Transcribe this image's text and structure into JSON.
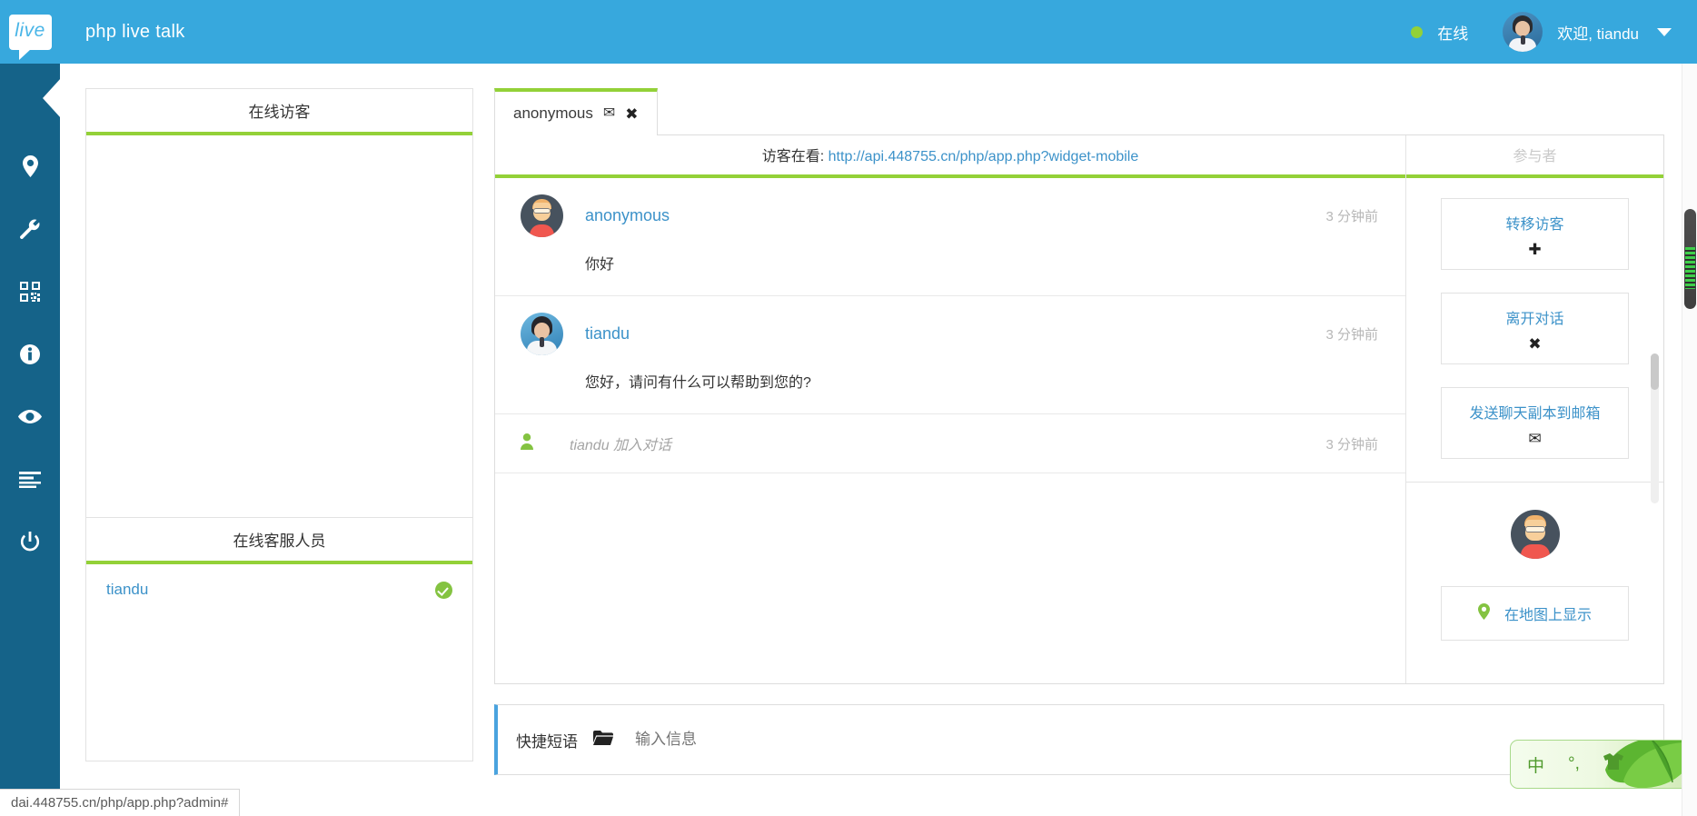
{
  "header": {
    "logo_text": "live",
    "app_title": "php live talk",
    "status_label": "在线",
    "welcome_label": "欢迎, tiandu",
    "accent_color": "#37a8dd",
    "status_dot_color": "#93d138"
  },
  "sidebar": {
    "items": [
      {
        "name": "location-pin-icon",
        "label": "地图"
      },
      {
        "name": "wrench-icon",
        "label": "设置"
      },
      {
        "name": "qrcode-icon",
        "label": "二维码"
      },
      {
        "name": "info-circle-icon",
        "label": "信息"
      },
      {
        "name": "eye-icon",
        "label": "监视"
      },
      {
        "name": "align-left-icon",
        "label": "日志"
      },
      {
        "name": "power-icon",
        "label": "退出"
      }
    ]
  },
  "visitors_panel": {
    "title": "在线访客",
    "rows": []
  },
  "agents_panel": {
    "title": "在线客服人员",
    "rows": [
      {
        "name": "tiandu",
        "online": true
      }
    ]
  },
  "chat": {
    "tab": {
      "label": "anonymous",
      "mail_icon": "✉",
      "close_icon": "✖"
    },
    "url_prefix": "访客在看:",
    "url": "http://api.448755.cn/php/app.php?widget-mobile",
    "messages": [
      {
        "author": "anonymous",
        "time": "3 分钟前",
        "text": "你好",
        "avatar": "anon"
      },
      {
        "author": "tiandu",
        "time": "3 分钟前",
        "text": "您好，请问有什么可以帮助到您的?",
        "avatar": "agent"
      }
    ],
    "system_message": {
      "text": "tiandu 加入对话",
      "time": "3 分钟前"
    }
  },
  "participants": {
    "title": "参与者",
    "buttons": [
      {
        "label": "转移访客",
        "icon": "✚"
      },
      {
        "label": "离开对话",
        "icon": "✖"
      },
      {
        "label": "发送聊天副本到邮箱",
        "icon": "✉"
      }
    ],
    "map_button": {
      "label": "在地图上显示",
      "icon": "pin"
    }
  },
  "composer": {
    "quick_phrases_label": "快捷短语",
    "folder_icon": "folder-icon",
    "input_value": "",
    "input_placeholder": "输入信息"
  },
  "ime": {
    "mode": "中",
    "punctuation": "°,",
    "skin": "shirt-icon"
  },
  "statusbar": {
    "url": "dai.448755.cn/php/app.php?admin#"
  }
}
